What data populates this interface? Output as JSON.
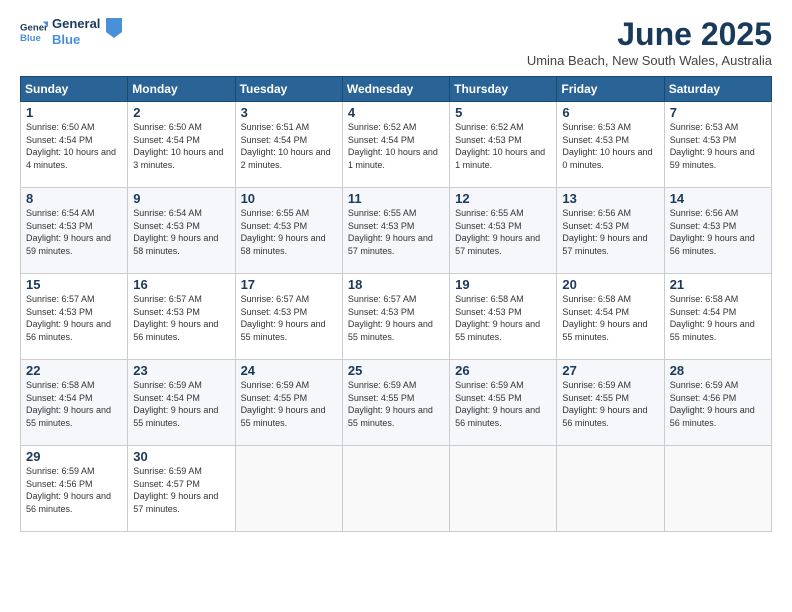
{
  "header": {
    "logo_general": "General",
    "logo_blue": "Blue",
    "month_title": "June 2025",
    "location": "Umina Beach, New South Wales, Australia"
  },
  "weekdays": [
    "Sunday",
    "Monday",
    "Tuesday",
    "Wednesday",
    "Thursday",
    "Friday",
    "Saturday"
  ],
  "weeks": [
    [
      {
        "day": "1",
        "sunrise": "6:50 AM",
        "sunset": "4:54 PM",
        "daylight": "10 hours and 4 minutes."
      },
      {
        "day": "2",
        "sunrise": "6:50 AM",
        "sunset": "4:54 PM",
        "daylight": "10 hours and 3 minutes."
      },
      {
        "day": "3",
        "sunrise": "6:51 AM",
        "sunset": "4:54 PM",
        "daylight": "10 hours and 2 minutes."
      },
      {
        "day": "4",
        "sunrise": "6:52 AM",
        "sunset": "4:54 PM",
        "daylight": "10 hours and 1 minute."
      },
      {
        "day": "5",
        "sunrise": "6:52 AM",
        "sunset": "4:53 PM",
        "daylight": "10 hours and 1 minute."
      },
      {
        "day": "6",
        "sunrise": "6:53 AM",
        "sunset": "4:53 PM",
        "daylight": "10 hours and 0 minutes."
      },
      {
        "day": "7",
        "sunrise": "6:53 AM",
        "sunset": "4:53 PM",
        "daylight": "9 hours and 59 minutes."
      }
    ],
    [
      {
        "day": "8",
        "sunrise": "6:54 AM",
        "sunset": "4:53 PM",
        "daylight": "9 hours and 59 minutes."
      },
      {
        "day": "9",
        "sunrise": "6:54 AM",
        "sunset": "4:53 PM",
        "daylight": "9 hours and 58 minutes."
      },
      {
        "day": "10",
        "sunrise": "6:55 AM",
        "sunset": "4:53 PM",
        "daylight": "9 hours and 58 minutes."
      },
      {
        "day": "11",
        "sunrise": "6:55 AM",
        "sunset": "4:53 PM",
        "daylight": "9 hours and 57 minutes."
      },
      {
        "day": "12",
        "sunrise": "6:55 AM",
        "sunset": "4:53 PM",
        "daylight": "9 hours and 57 minutes."
      },
      {
        "day": "13",
        "sunrise": "6:56 AM",
        "sunset": "4:53 PM",
        "daylight": "9 hours and 57 minutes."
      },
      {
        "day": "14",
        "sunrise": "6:56 AM",
        "sunset": "4:53 PM",
        "daylight": "9 hours and 56 minutes."
      }
    ],
    [
      {
        "day": "15",
        "sunrise": "6:57 AM",
        "sunset": "4:53 PM",
        "daylight": "9 hours and 56 minutes."
      },
      {
        "day": "16",
        "sunrise": "6:57 AM",
        "sunset": "4:53 PM",
        "daylight": "9 hours and 56 minutes."
      },
      {
        "day": "17",
        "sunrise": "6:57 AM",
        "sunset": "4:53 PM",
        "daylight": "9 hours and 55 minutes."
      },
      {
        "day": "18",
        "sunrise": "6:57 AM",
        "sunset": "4:53 PM",
        "daylight": "9 hours and 55 minutes."
      },
      {
        "day": "19",
        "sunrise": "6:58 AM",
        "sunset": "4:53 PM",
        "daylight": "9 hours and 55 minutes."
      },
      {
        "day": "20",
        "sunrise": "6:58 AM",
        "sunset": "4:54 PM",
        "daylight": "9 hours and 55 minutes."
      },
      {
        "day": "21",
        "sunrise": "6:58 AM",
        "sunset": "4:54 PM",
        "daylight": "9 hours and 55 minutes."
      }
    ],
    [
      {
        "day": "22",
        "sunrise": "6:58 AM",
        "sunset": "4:54 PM",
        "daylight": "9 hours and 55 minutes."
      },
      {
        "day": "23",
        "sunrise": "6:59 AM",
        "sunset": "4:54 PM",
        "daylight": "9 hours and 55 minutes."
      },
      {
        "day": "24",
        "sunrise": "6:59 AM",
        "sunset": "4:55 PM",
        "daylight": "9 hours and 55 minutes."
      },
      {
        "day": "25",
        "sunrise": "6:59 AM",
        "sunset": "4:55 PM",
        "daylight": "9 hours and 55 minutes."
      },
      {
        "day": "26",
        "sunrise": "6:59 AM",
        "sunset": "4:55 PM",
        "daylight": "9 hours and 56 minutes."
      },
      {
        "day": "27",
        "sunrise": "6:59 AM",
        "sunset": "4:55 PM",
        "daylight": "9 hours and 56 minutes."
      },
      {
        "day": "28",
        "sunrise": "6:59 AM",
        "sunset": "4:56 PM",
        "daylight": "9 hours and 56 minutes."
      }
    ],
    [
      {
        "day": "29",
        "sunrise": "6:59 AM",
        "sunset": "4:56 PM",
        "daylight": "9 hours and 56 minutes."
      },
      {
        "day": "30",
        "sunrise": "6:59 AM",
        "sunset": "4:57 PM",
        "daylight": "9 hours and 57 minutes."
      },
      null,
      null,
      null,
      null,
      null
    ]
  ],
  "labels": {
    "sunrise": "Sunrise:",
    "sunset": "Sunset:",
    "daylight": "Daylight:"
  }
}
